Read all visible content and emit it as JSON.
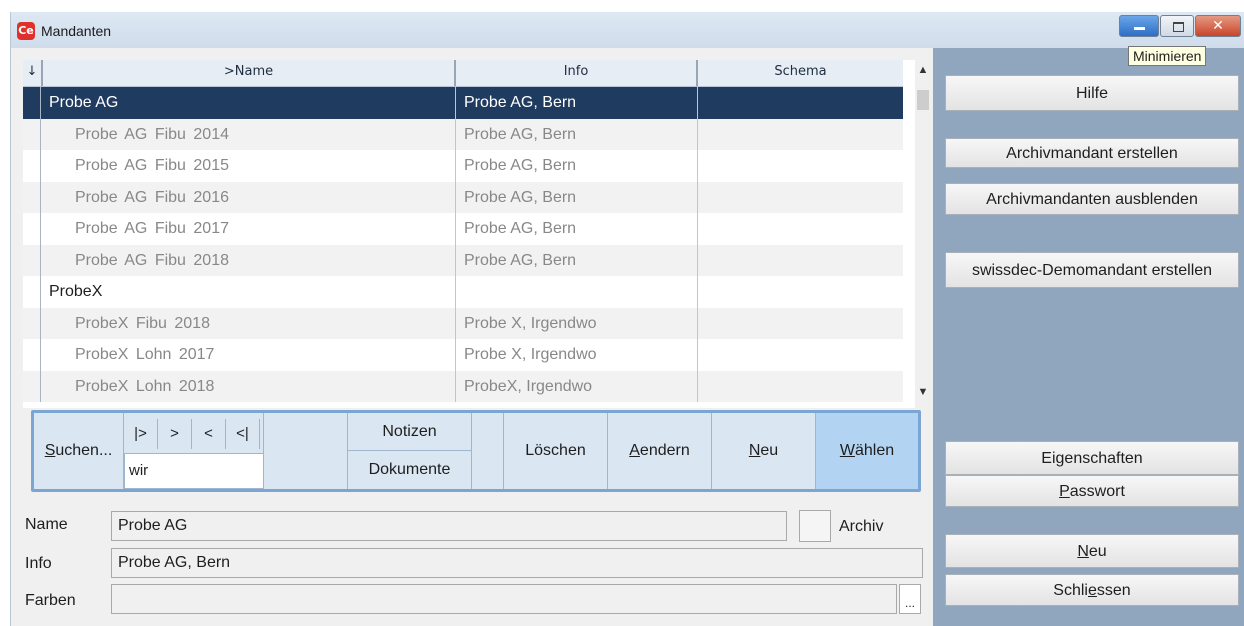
{
  "window": {
    "title": "Mandanten",
    "app_icon_text": "Ce",
    "tooltip": "Minimieren"
  },
  "grid": {
    "sort_indicator": "↓",
    "columns": [
      ">Name",
      "Info",
      "Schema"
    ],
    "rows": [
      {
        "name": "Probe AG",
        "info": "Probe AG, Bern",
        "schema": "",
        "child": false,
        "selected": true
      },
      {
        "name": "Probe AG Fibu 2014",
        "info": "Probe AG, Bern",
        "schema": "",
        "child": true,
        "selected": false
      },
      {
        "name": "Probe AG Fibu 2015",
        "info": "Probe AG, Bern",
        "schema": "",
        "child": true,
        "selected": false
      },
      {
        "name": "Probe AG Fibu 2016",
        "info": "Probe AG, Bern",
        "schema": "",
        "child": true,
        "selected": false
      },
      {
        "name": "Probe AG Fibu 2017",
        "info": "Probe AG, Bern",
        "schema": "",
        "child": true,
        "selected": false
      },
      {
        "name": "Probe AG Fibu 2018",
        "info": "Probe AG, Bern",
        "schema": "",
        "child": true,
        "selected": false
      },
      {
        "name": "ProbeX",
        "info": "",
        "schema": "",
        "child": false,
        "selected": false
      },
      {
        "name": "ProbeX Fibu 2018",
        "info": "Probe X, Irgendwo",
        "schema": "",
        "child": true,
        "selected": false
      },
      {
        "name": "ProbeX Lohn 2017",
        "info": "Probe X, Irgendwo",
        "schema": "",
        "child": true,
        "selected": false
      },
      {
        "name": "ProbeX Lohn 2018",
        "info": "ProbeX, Irgendwo",
        "schema": "",
        "child": true,
        "selected": false
      }
    ]
  },
  "toolbar": {
    "search_label_first": "S",
    "search_label_rest": "uchen...",
    "nav": [
      "|>",
      ">",
      "<",
      "<|"
    ],
    "search_value": "wir",
    "notes_label": "Notizen",
    "documents_label": "Dokumente",
    "delete_label": "Löschen",
    "edit_first": "A",
    "edit_rest": "endern",
    "new_first": "N",
    "new_rest": "eu",
    "choose_first": "W",
    "choose_rest": "ählen"
  },
  "fields": {
    "name_label": "Name",
    "name_value": "Probe AG",
    "archiv_label": "Archiv",
    "info_label": "Info",
    "info_value": "Probe AG, Bern",
    "colors_label": "Farben",
    "colors_value": "",
    "dots": "..."
  },
  "side": {
    "help": "Hilfe",
    "create_archive": "Archivmandant erstellen",
    "hide_archives": "Archivmandanten ausblenden",
    "swissdec": "swissdec-Demomandant erstellen",
    "properties_a": "Ei",
    "properties_u": "g",
    "properties_b": "enschaften",
    "password_u": "P",
    "password_rest": "asswort",
    "new_u": "N",
    "new_rest": "eu",
    "close_a": "Schli",
    "close_u": "e",
    "close_b": "ssen"
  }
}
